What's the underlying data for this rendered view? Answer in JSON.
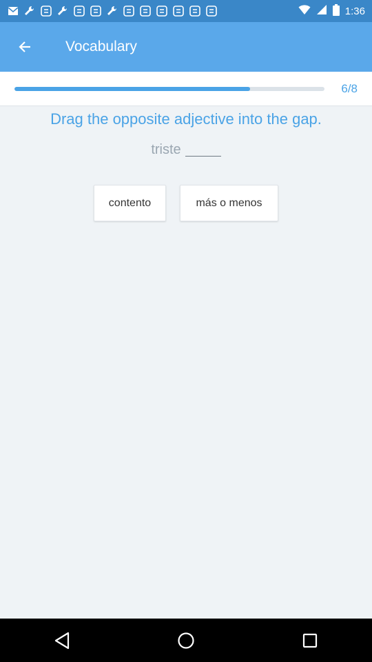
{
  "status_bar": {
    "time": "1:36",
    "notification_icons": [
      "mail-icon",
      "wrench-icon",
      "currency-icon",
      "wrench-icon",
      "currency-icon",
      "currency-icon",
      "wrench-icon",
      "currency-icon",
      "currency-icon",
      "currency-icon",
      "currency-icon",
      "currency-icon",
      "currency-icon"
    ]
  },
  "app_bar": {
    "title": "Vocabulary"
  },
  "progress": {
    "current": 6,
    "total": 8,
    "label": "6/8",
    "fraction": 0.76
  },
  "exercise": {
    "instruction": "Drag the opposite adjective into the gap.",
    "prompt_word": "triste",
    "options": [
      "contento",
      "más o menos"
    ]
  },
  "colors": {
    "status_bar": "#3a87c8",
    "app_bar": "#5aa8ea",
    "accent": "#4aa3e6",
    "background": "#eff3f6"
  }
}
